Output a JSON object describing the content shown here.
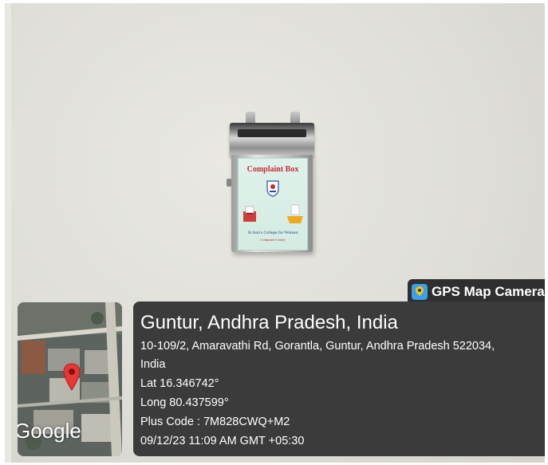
{
  "photo": {
    "poster": {
      "title": "Complaint Box",
      "college": "St.Ann's College for Women",
      "subtitle": "Computer Center"
    }
  },
  "overlay": {
    "app_label": "GPS Map Camera",
    "app_icon": "gps-map-camera-icon",
    "map_watermark": "Google",
    "location_title": "Guntur, Andhra Pradesh, India",
    "address_line1": "10-109/2, Amaravathi Rd, Gorantla, Guntur, Andhra Pradesh 522034,",
    "address_line2": "India",
    "latitude": "Lat 16.346742°",
    "longitude": "Long 80.437599°",
    "plus_code": "Plus Code : 7M828CWQ+M2",
    "timestamp": "09/12/23 11:09 AM GMT +05:30"
  },
  "colors": {
    "panel_bg": "#3b3b3b",
    "label_bg": "#2f2f2f",
    "poster_title": "#c52a3a",
    "map_pin": "#e53935"
  }
}
